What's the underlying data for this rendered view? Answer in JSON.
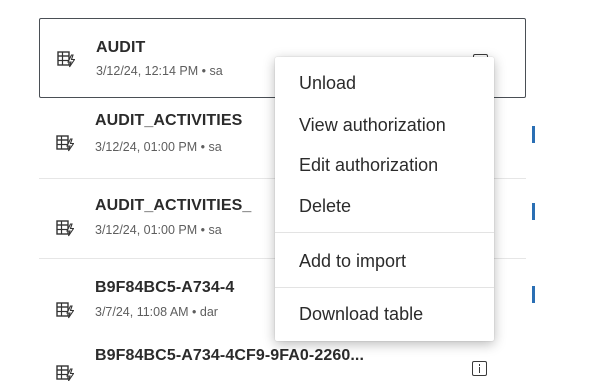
{
  "tables": [
    {
      "name": "AUDIT",
      "meta": "3/12/24, 12:14 PM • sa",
      "selected": true
    },
    {
      "name": "AUDIT_ACTIVITIES",
      "meta": "3/12/24, 01:00 PM • sa"
    },
    {
      "name": "AUDIT_ACTIVITIES_",
      "meta": "3/12/24, 01:00 PM • sa"
    },
    {
      "name": "B9F84BC5-A734-4",
      "meta": "3/7/24, 11:08 AM • dar"
    },
    {
      "name": "B9F84BC5-A734-4CF9-9FA0-2260...",
      "meta": ""
    }
  ],
  "context_menu": {
    "items": [
      "Unload",
      "View authorization",
      "Edit authorization",
      "Delete",
      "Add to import",
      "Download table"
    ]
  },
  "icons": {
    "table": "table-icon",
    "info": "info-icon"
  },
  "colors": {
    "selected_border": "#4a4f55",
    "accent": "#2a6fb4"
  }
}
